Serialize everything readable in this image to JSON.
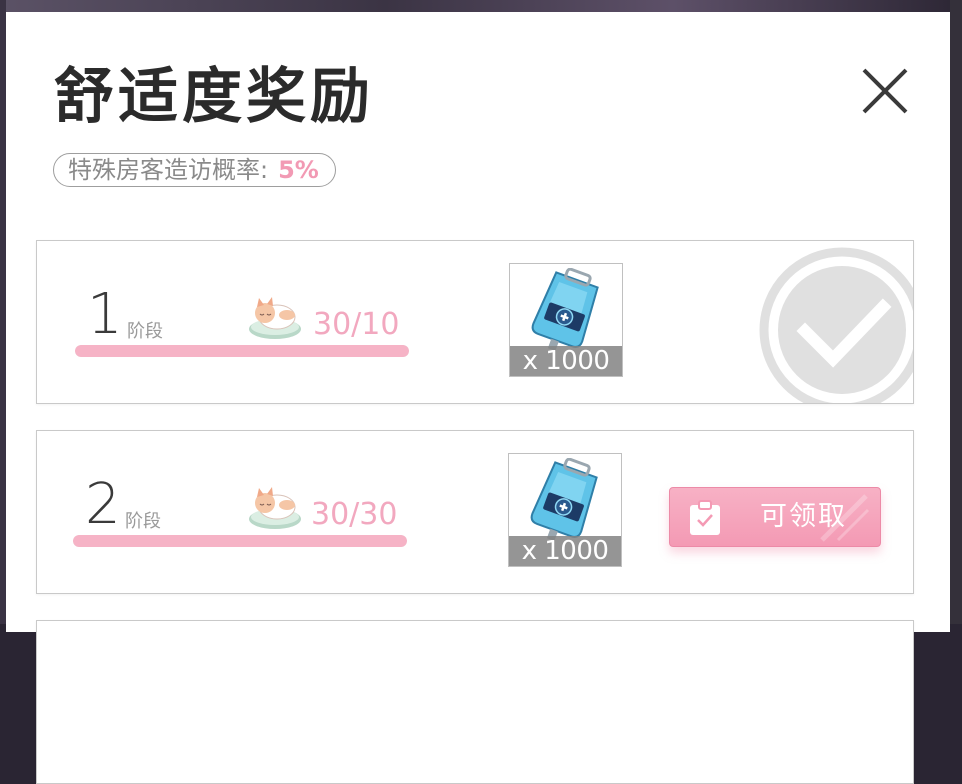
{
  "dialog": {
    "title": "舒适度奖励",
    "rate_label": "特殊房客造访概率:",
    "rate_value": "5%"
  },
  "stages": [
    {
      "number": "1",
      "label": "阶段",
      "progress": "30/10",
      "progress_fraction": 1.0,
      "reward_qty": "x 1000",
      "reward_icon": "drip-bag-icon",
      "status": "claimed"
    },
    {
      "number": "2",
      "label": "阶段",
      "progress": "30/30",
      "progress_fraction": 1.0,
      "reward_qty": "x 1000",
      "reward_icon": "drip-bag-icon",
      "status": "claimable",
      "claim_label": "可领取"
    }
  ],
  "colors": {
    "accent_pink": "#f29ab4",
    "bar_pink": "#f6b3c6",
    "title": "#2b2b2b"
  }
}
